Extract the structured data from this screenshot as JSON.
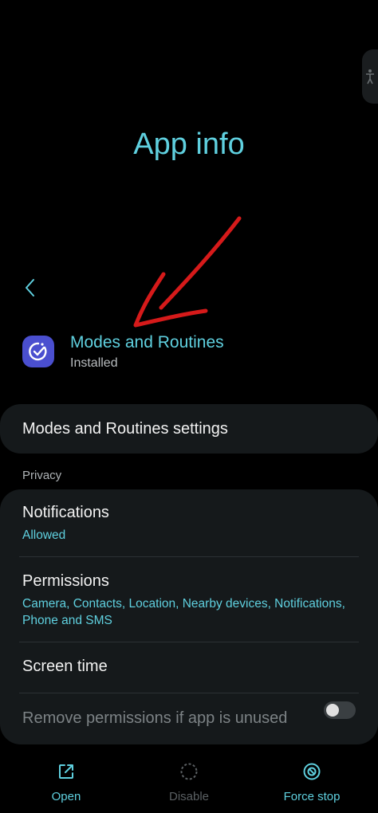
{
  "header": {
    "title": "App info"
  },
  "app": {
    "name": "Modes and Routines",
    "status": "Installed"
  },
  "settings_card": {
    "label": "Modes and Routines settings"
  },
  "privacy": {
    "section_label": "Privacy",
    "notifications": {
      "title": "Notifications",
      "value": "Allowed"
    },
    "permissions": {
      "title": "Permissions",
      "value": "Camera, Contacts, Location, Nearby devices, Notifications, Phone and SMS"
    },
    "screen_time": {
      "title": "Screen time"
    },
    "remove_permissions": {
      "title": "Remove permissions if app is unused",
      "enabled": false
    }
  },
  "actions": {
    "open": "Open",
    "disable": "Disable",
    "force_stop": "Force stop"
  },
  "colors": {
    "accent": "#5fd0df",
    "background": "#000000",
    "card": "#15191b",
    "annotation": "#d61a1a",
    "app_icon": "#4a4fcf"
  },
  "icons": {
    "back": "chevron-left-icon",
    "app": "modes-routines-icon",
    "open": "open-external-icon",
    "disable": "disable-dashed-circle-icon",
    "force_stop": "force-stop-icon"
  }
}
